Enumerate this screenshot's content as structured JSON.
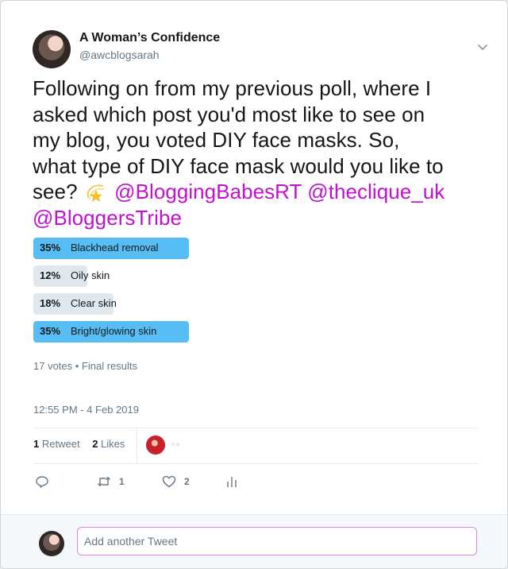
{
  "author": {
    "name": "A Woman’s Confidence",
    "handle": "@awcblogsarah"
  },
  "tweet": {
    "line1": "Following on from my previous poll, where I",
    "line2": "asked which post you'd most like to see on",
    "line3": "my blog, you voted DIY face masks. So,",
    "line4": "what type of DIY face mask would you like to",
    "line5_start": "see?",
    "mention1": "@BloggingBabesRT",
    "mention2": "@theclique_uk",
    "mention3": "@BloggersTribe",
    "emoji_icon": "dizzy-star-emoji"
  },
  "poll": {
    "choices": [
      {
        "percent_label": "35%",
        "percent": 35,
        "label": "Blackhead removal",
        "winner": true
      },
      {
        "percent_label": "12%",
        "percent": 12,
        "label": "Oily skin",
        "winner": false
      },
      {
        "percent_label": "18%",
        "percent": 18,
        "label": "Clear skin",
        "winner": false
      },
      {
        "percent_label": "35%",
        "percent": 35,
        "label": "Bright/glowing skin",
        "winner": true
      }
    ],
    "meta": "17 votes • Final results"
  },
  "timestamp": "12:55 PM - 4 Feb 2019",
  "stats": {
    "retweets_count": "1",
    "retweets_label": "Retweet",
    "likes_count": "2",
    "likes_label": "Likes"
  },
  "actions": {
    "reply_icon": "reply-icon",
    "retweet_icon": "retweet-icon",
    "retweet_count": "1",
    "like_icon": "heart-icon",
    "like_count": "2",
    "analytics_icon": "analytics-icon"
  },
  "reply": {
    "placeholder": "Add another Tweet"
  },
  "colors": {
    "mention": "#c010d0",
    "poll_winner": "#56bef5",
    "poll_other": "#e1e8ed",
    "reply_border": "#d38be3"
  }
}
